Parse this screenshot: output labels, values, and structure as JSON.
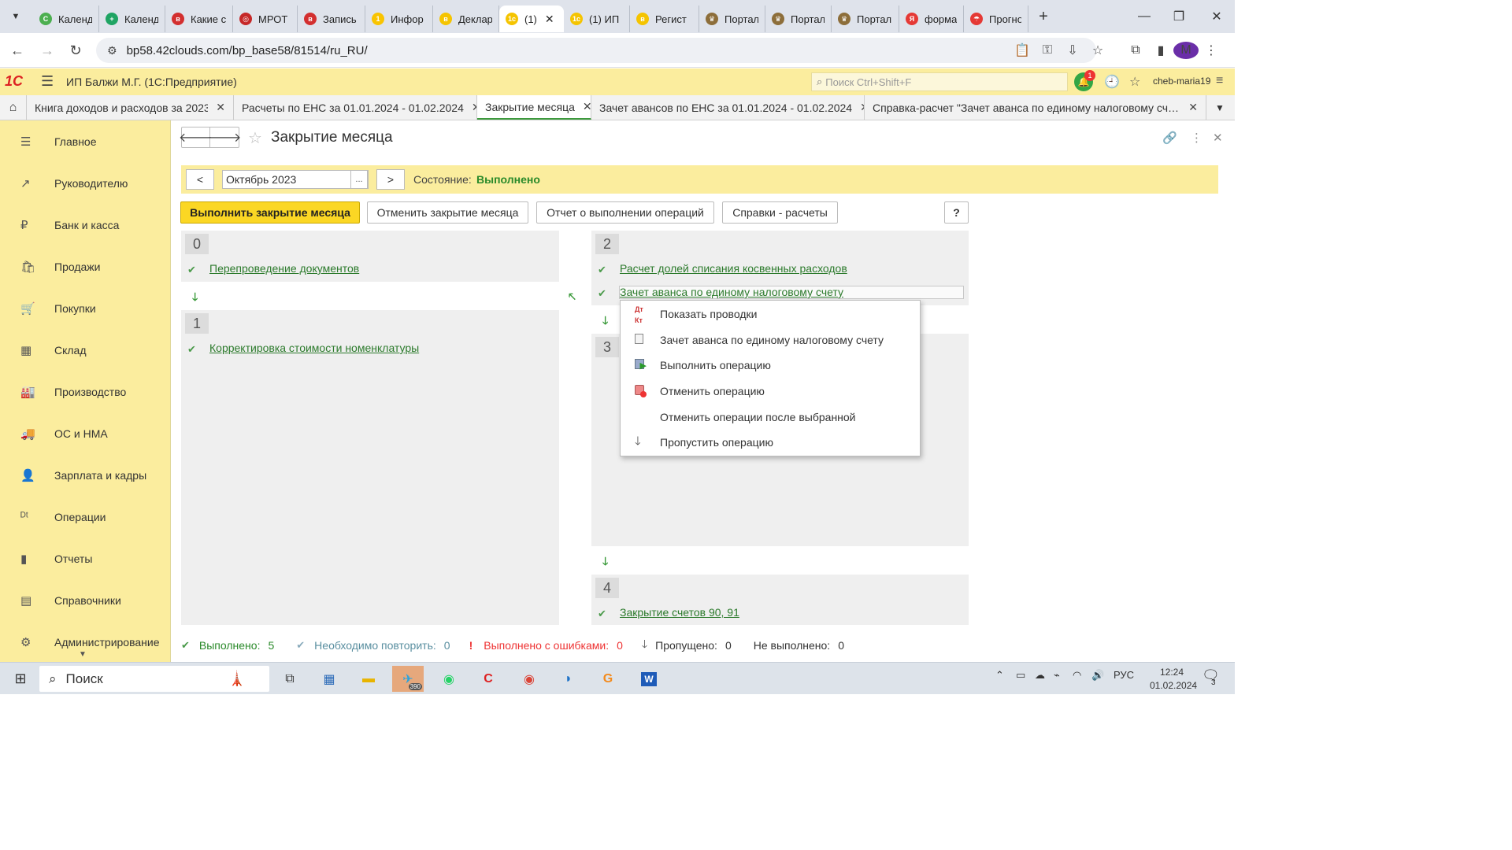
{
  "browser": {
    "tabs": [
      {
        "title": "Календ",
        "color": "#4caf50",
        "glyph": "C"
      },
      {
        "title": "Календ",
        "color": "#1fa463",
        "glyph": "+"
      },
      {
        "title": "Какие с",
        "color": "#d32f2f",
        "glyph": "в"
      },
      {
        "title": "МРОТ",
        "color": "#c62828",
        "glyph": "◎"
      },
      {
        "title": "Запись",
        "color": "#d32f2f",
        "glyph": "в"
      },
      {
        "title": "Инфор",
        "color": "#f9c400",
        "glyph": "1"
      },
      {
        "title": "Деклар",
        "color": "#f5c400",
        "glyph": "в"
      },
      {
        "title": "(1)",
        "color": "#f5c400",
        "glyph": "1c",
        "active": true
      },
      {
        "title": "(1) ИП",
        "color": "#f5c400",
        "glyph": "1c"
      },
      {
        "title": "Регист",
        "color": "#f5c400",
        "glyph": "в"
      },
      {
        "title": "Портал",
        "color": "#8d6e3a",
        "glyph": "♛"
      },
      {
        "title": "Портал",
        "color": "#8d6e3a",
        "glyph": "♛"
      },
      {
        "title": "Портал",
        "color": "#8d6e3a",
        "glyph": "♛"
      },
      {
        "title": "форма",
        "color": "#e53935",
        "glyph": "Я"
      },
      {
        "title": "Прогно",
        "color": "#e53935",
        "glyph": "☂"
      }
    ],
    "url": "bp58.42clouds.com/bp_base58/81514/ru_RU/",
    "profile_initial": "M"
  },
  "app": {
    "logo": "1С",
    "title": "ИП Балжи М.Г.  (1С:Предприятие)",
    "search_placeholder": "Поиск Ctrl+Shift+F",
    "notifications": "1",
    "user": "cheb-maria19"
  },
  "open_tabs": [
    {
      "label": "Книга доходов и расходов за 2023 г."
    },
    {
      "label": "Расчеты по ЕНС за 01.01.2024 - 01.02.2024"
    },
    {
      "label": "Закрытие месяца",
      "active": true
    },
    {
      "label": "Зачет авансов по ЕНС за 01.01.2024 - 01.02.2024"
    },
    {
      "label": "Справка-расчет \"Зачет аванса по единому налоговому счету..."
    }
  ],
  "sidebar": {
    "items": [
      {
        "label": "Главное",
        "icon": "menu-icon",
        "glyph": "☰"
      },
      {
        "label": "Руководителю",
        "icon": "trend-icon",
        "glyph": "↗"
      },
      {
        "label": "Банк и касса",
        "icon": "ruble-icon",
        "glyph": "₽"
      },
      {
        "label": "Продажи",
        "icon": "bag-icon",
        "glyph": "🛍"
      },
      {
        "label": "Покупки",
        "icon": "cart-icon",
        "glyph": "🛒"
      },
      {
        "label": "Склад",
        "icon": "grid-icon",
        "glyph": "▦"
      },
      {
        "label": "Производство",
        "icon": "factory-icon",
        "glyph": "🏭"
      },
      {
        "label": "ОС и НМА",
        "icon": "truck-icon",
        "glyph": "🚚"
      },
      {
        "label": "Зарплата и кадры",
        "icon": "person-icon",
        "glyph": "👤"
      },
      {
        "label": "Операции",
        "icon": "dtkt-icon",
        "glyph": "ᴰᵗ"
      },
      {
        "label": "Отчеты",
        "icon": "bar-chart-icon",
        "glyph": "▮"
      },
      {
        "label": "Справочники",
        "icon": "book-icon",
        "glyph": "▤"
      },
      {
        "label": "Администрирование",
        "icon": "gear-icon",
        "glyph": "⚙"
      }
    ]
  },
  "form": {
    "title": "Закрытие месяца",
    "period": "Октябрь 2023",
    "prev_label": "<",
    "next_label": ">",
    "dots_label": "...",
    "state_label": "Состояние:",
    "state_value": "Выполнено",
    "buttons": {
      "run": "Выполнить закрытие месяца",
      "cancel": "Отменить закрытие месяца",
      "report": "Отчет о выполнении операций",
      "refs": "Справки - расчеты",
      "help": "?"
    },
    "steps": [
      {
        "num": "0",
        "ops": [
          "Перепроведение документов"
        ]
      },
      {
        "num": "1",
        "ops": [
          "Корректировка стоимости номенклатуры"
        ]
      },
      {
        "num": "2",
        "ops": [
          "Расчет долей списания косвенных расходов",
          "Зачет аванса по единому налоговому счету"
        ]
      },
      {
        "num": "3",
        "ops": []
      },
      {
        "num": "4",
        "ops": [
          "Закрытие счетов 90, 91"
        ]
      }
    ]
  },
  "context_menu": {
    "items": [
      {
        "label": "Показать проводки",
        "icon": "dtkt-icon"
      },
      {
        "label": "Зачет аванса по единому налоговому счету",
        "icon": "document-icon"
      },
      {
        "label": "Выполнить операцию",
        "icon": "run-operation-icon"
      },
      {
        "label": "Отменить операцию",
        "icon": "cancel-operation-icon"
      },
      {
        "label": "Отменить операции после выбранной",
        "icon": ""
      },
      {
        "label": "Пропустить операцию",
        "icon": "arrow-down-icon"
      }
    ]
  },
  "footer": {
    "done_label": "Выполнено:",
    "done_value": "5",
    "repeat_label": "Необходимо повторить:",
    "repeat_value": "0",
    "errors_label": "Выполнено с ошибками:",
    "errors_value": "0",
    "skipped_label": "Пропущено:",
    "skipped_value": "0",
    "notdone_label": "Не выполнено:",
    "notdone_value": "0"
  },
  "taskbar": {
    "search_label": "Поиск",
    "telegram_badge": "390",
    "lang": "РУС",
    "time": "12:24",
    "date": "01.02.2024",
    "notif_count": "3"
  },
  "colors": {
    "accent_yellow": "#fbed9e",
    "primary_button": "#fbd724",
    "link_green": "#2b7a2b",
    "error_red": "#e33"
  }
}
